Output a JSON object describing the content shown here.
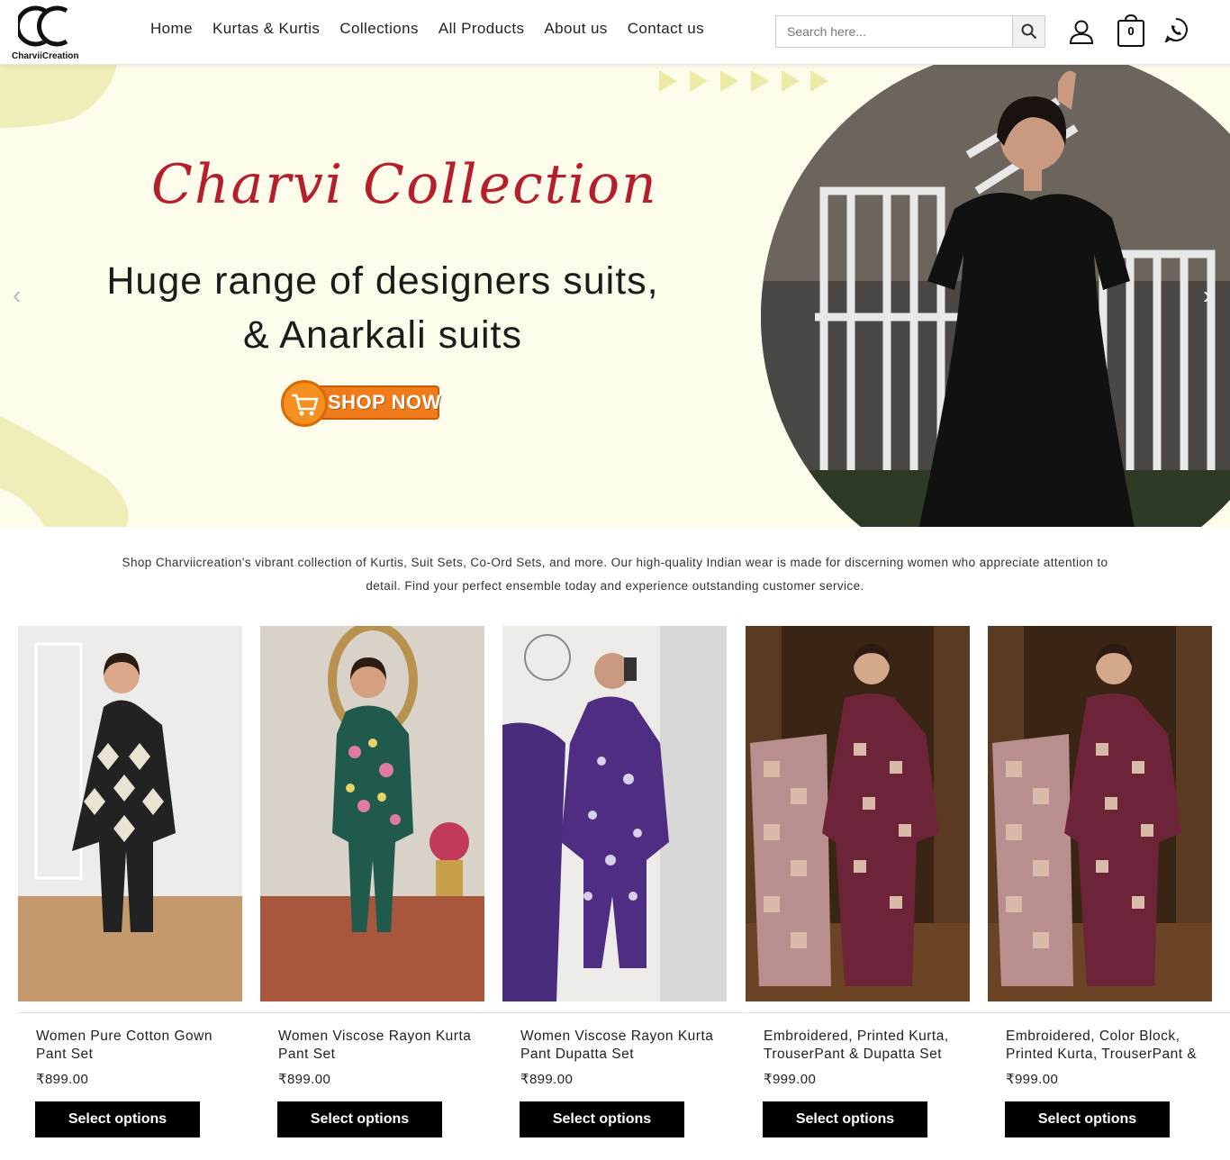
{
  "brand": {
    "name": "CharviiCreation",
    "accent": "#b51f2b",
    "cta": "#f07b1a"
  },
  "nav": {
    "items": [
      {
        "label": "Home"
      },
      {
        "label": "Kurtas & Kurtis"
      },
      {
        "label": "Collections"
      },
      {
        "label": "All Products"
      },
      {
        "label": "About us"
      },
      {
        "label": "Contact us"
      }
    ]
  },
  "search": {
    "placeholder": "Search here..."
  },
  "cart": {
    "count": "0"
  },
  "hero": {
    "title": "Charvi Collection",
    "subtitle_line1": "Huge range of designers suits,",
    "subtitle_line2": "& Anarkali suits",
    "cta": "SHOP NOW"
  },
  "description": "Shop Charviicreation's vibrant collection of Kurtis, Suit Sets, Co-Ord Sets, and more. Our high-quality Indian wear is made for discerning women who appreciate attention to detail. Find your perfect ensemble today and experience outstanding customer service.",
  "products": [
    {
      "name": "Women Pure Cotton Gown Pant Set",
      "price": "₹899.00",
      "button": "Select options"
    },
    {
      "name": "Women Viscose Rayon Kurta Pant Set",
      "price": "₹899.00",
      "button": "Select options"
    },
    {
      "name": "Women Viscose Rayon Kurta Pant Dupatta Set",
      "price": "₹899.00",
      "button": "Select options"
    },
    {
      "name": "Embroidered, Printed Kurta, TrouserPant & Dupatta Set",
      "price": "₹999.00",
      "button": "Select options"
    },
    {
      "name": "Embroidered, Color Block, Printed Kurta, TrouserPant & Dupatta Set",
      "price": "₹999.00",
      "button": "Select options"
    }
  ]
}
